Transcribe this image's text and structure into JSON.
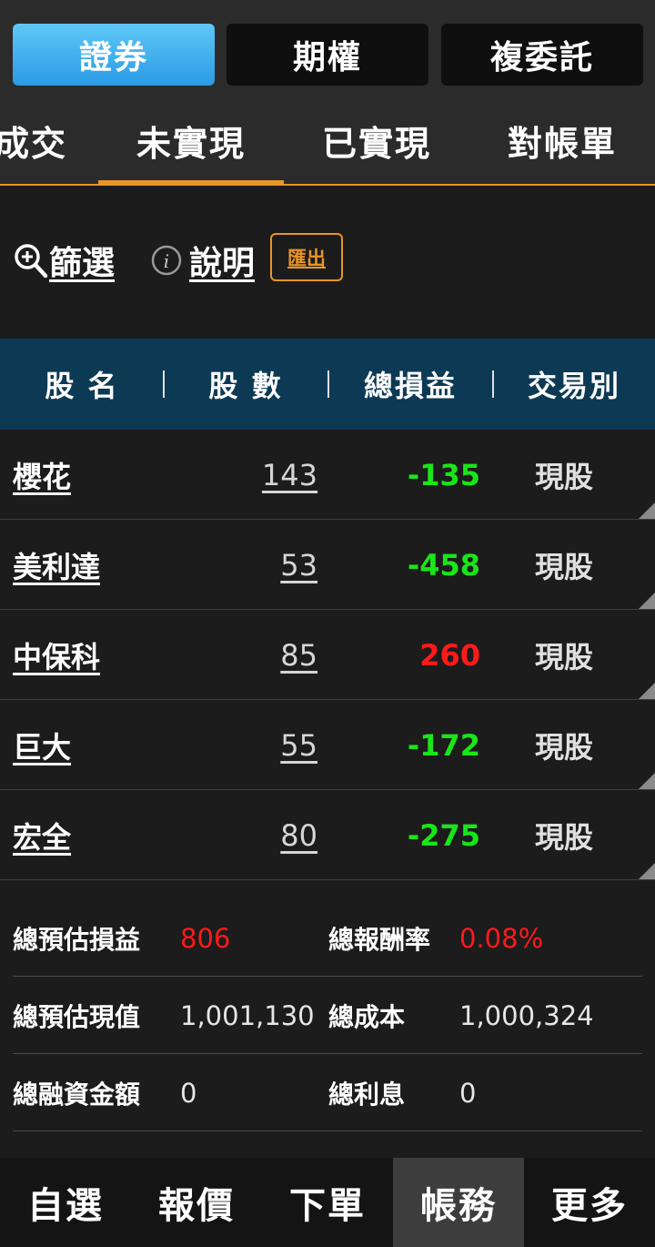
{
  "segments": [
    {
      "label": "證券",
      "active": true
    },
    {
      "label": "期權",
      "active": false
    },
    {
      "label": "複委託",
      "active": false
    }
  ],
  "tabs": [
    {
      "label": "成交"
    },
    {
      "label": "未實現"
    },
    {
      "label": "已實現"
    },
    {
      "label": "對帳單"
    }
  ],
  "toolbar": {
    "filter_label": "篩選",
    "help_label": "說明",
    "export_label": "匯出"
  },
  "table": {
    "headers": [
      "股 名",
      "股 數",
      "總損益",
      "交易別"
    ],
    "rows": [
      {
        "name": "櫻花",
        "shares": "143",
        "pl": "-135",
        "type": "現股"
      },
      {
        "name": "美利達",
        "shares": "53",
        "pl": "-458",
        "type": "現股"
      },
      {
        "name": "中保科",
        "shares": "85",
        "pl": "260",
        "type": "現股"
      },
      {
        "name": "巨大",
        "shares": "55",
        "pl": "-172",
        "type": "現股"
      },
      {
        "name": "宏全",
        "shares": "80",
        "pl": "-275",
        "type": "現股"
      }
    ]
  },
  "summary": {
    "est_pl_label": "總預估損益",
    "est_pl_value": "806",
    "return_label": "總報酬率",
    "return_value": "0.08%",
    "est_value_label": "總預估現值",
    "est_value_value": "1,001,130",
    "cost_label": "總成本",
    "cost_value": "1,000,324",
    "margin_label": "總融資金額",
    "margin_value": "0",
    "interest_label": "總利息",
    "interest_value": "0"
  },
  "nav": [
    {
      "label": "自選"
    },
    {
      "label": "報價"
    },
    {
      "label": "下單"
    },
    {
      "label": "帳務"
    },
    {
      "label": "更多"
    }
  ],
  "colors": {
    "accent": "#e89527",
    "active_segment": "#2a9be6",
    "gain": "#ff1a1a",
    "loss": "#19e619",
    "header_bg": "#0c3a55"
  }
}
